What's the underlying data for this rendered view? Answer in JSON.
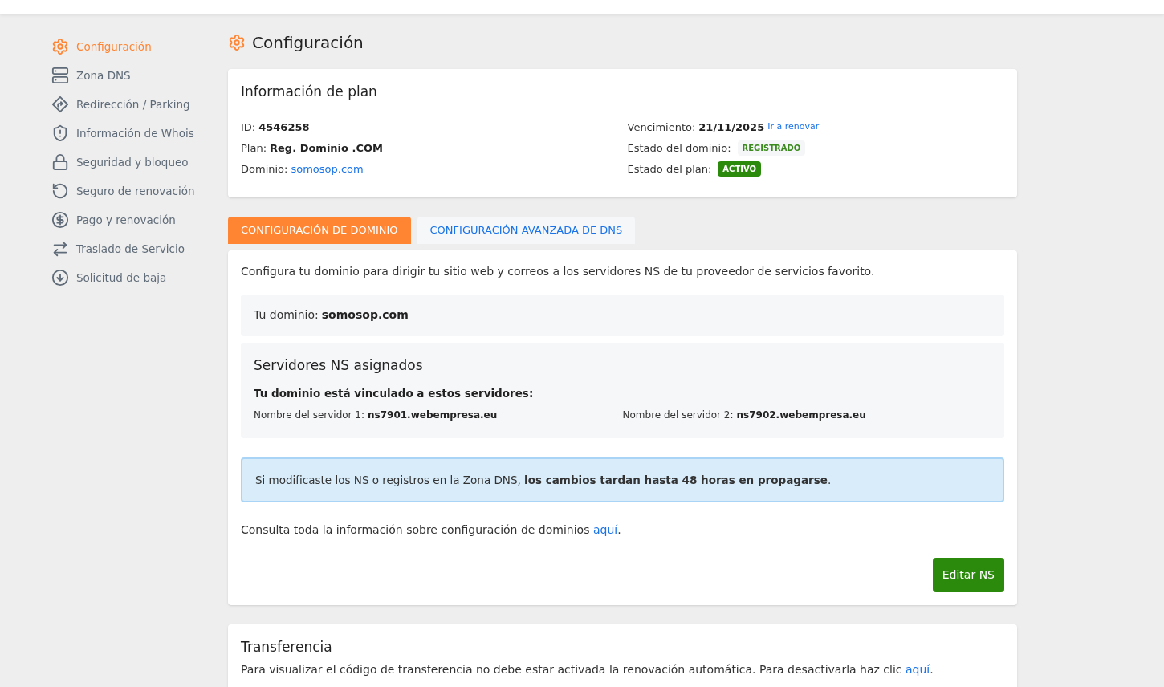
{
  "sidebar": {
    "items": [
      {
        "label": "Configuración",
        "selected": true
      },
      {
        "label": "Zona DNS",
        "selected": false
      },
      {
        "label": "Redirección / Parking",
        "selected": false
      },
      {
        "label": "Información de Whois",
        "selected": false
      },
      {
        "label": "Seguridad y bloqueo",
        "selected": false
      },
      {
        "label": "Seguro de renovación",
        "selected": false
      },
      {
        "label": "Pago y renovación",
        "selected": false
      },
      {
        "label": "Traslado de Servicio",
        "selected": false
      },
      {
        "label": "Solicitud de baja",
        "selected": false
      }
    ]
  },
  "page_title": "Configuración",
  "plan": {
    "title": "Información de plan",
    "left": [
      {
        "label": "ID:",
        "value": "4546258",
        "kind": "bold"
      },
      {
        "label": "Plan:",
        "value": "Reg. Dominio .COM",
        "kind": "bold"
      },
      {
        "label": "Dominio:",
        "value": "somosop.com",
        "kind": "link"
      }
    ],
    "right": [
      {
        "label": "Vencimiento:",
        "value": "21/11/2025",
        "kind": "bold",
        "link": "Ir a renovar"
      },
      {
        "label": "Estado del dominio:",
        "value": "REGISTRADO",
        "kind": "badge-light"
      },
      {
        "label": "Estado del plan:",
        "value": "ACTIVO",
        "kind": "badge-solid"
      }
    ]
  },
  "tabs": [
    {
      "label": "CONFIGURACIÓN DE DOMINIO",
      "selected": true
    },
    {
      "label": "CONFIGURACIÓN AVANZADA DE DNS",
      "selected": false
    }
  ],
  "config": {
    "intro": "Configura tu dominio para dirigir tu sitio web y correos a los servidores NS de tu proveedor de servicios favorito.",
    "domain": {
      "label": "Tu dominio:",
      "value": "somosop.com"
    },
    "ns": {
      "title": "Servidores NS asignados",
      "subtitle": "Tu dominio está vinculado a estos servidores:",
      "servers": [
        {
          "label": "Nombre del servidor 1:",
          "value": "ns7901.webempresa.eu"
        },
        {
          "label": "Nombre del servidor 2:",
          "value": "ns7902.webempresa.eu"
        }
      ]
    },
    "alert": "Si modificaste los NS o registros en la Zona DNS, **los cambios tardan hasta 48 horas en propagarse**.",
    "info": {
      "before": "Consulta toda la información sobre configuración de dominios ",
      "link": "aquí",
      "after": "."
    },
    "button": "Editar NS"
  },
  "transfer": {
    "title": "Transferencia",
    "text": {
      "before": "Para visualizar el código de transferencia no debe estar activada la renovación automática. Para desactivarla haz clic ",
      "link": "aquí",
      "after": "."
    }
  }
}
